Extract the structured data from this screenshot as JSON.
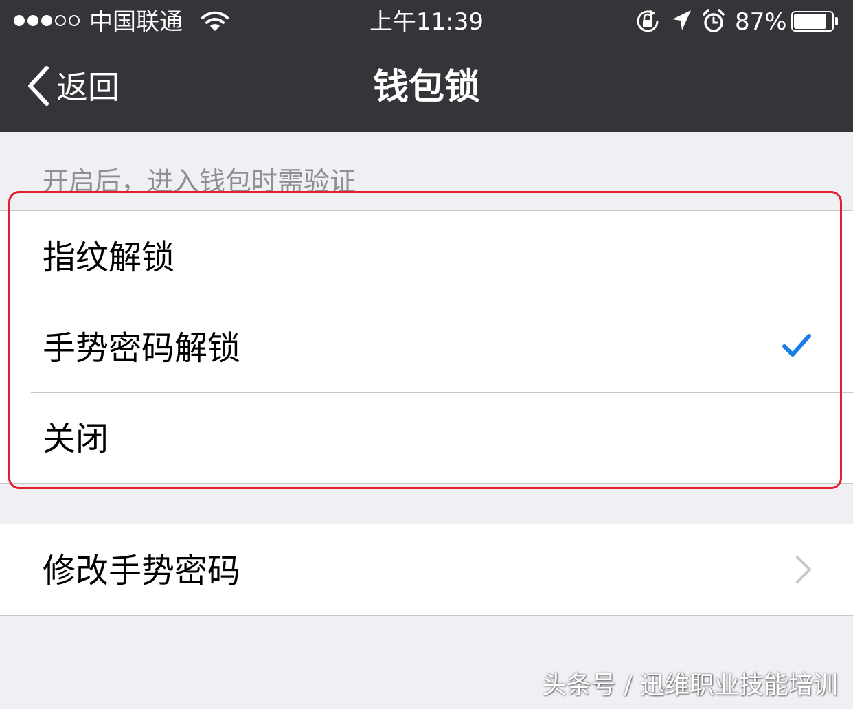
{
  "status_bar": {
    "carrier": "中国联通",
    "time": "上午11:39",
    "battery": "87%",
    "signal_bars_filled": 3,
    "signal_bars_total": 5,
    "battery_level": 0.87,
    "icons": [
      "wifi-icon",
      "rotation-lock-icon",
      "location-arrow-icon",
      "alarm-icon",
      "battery-icon"
    ]
  },
  "nav": {
    "back_label": "返回",
    "title": "钱包锁"
  },
  "lock_section": {
    "caption": "开启后，进入钱包时需验证",
    "options": [
      {
        "label": "指纹解锁",
        "selected": false
      },
      {
        "label": "手势密码解锁",
        "selected": true
      },
      {
        "label": "关闭",
        "selected": false
      }
    ]
  },
  "gesture_section": {
    "change_label": "修改手势密码"
  },
  "watermark": "头条号 / 迅维职业技能培训",
  "colors": {
    "nav_background": "#353539",
    "page_background": "#efeff4",
    "checkmark": "#1a7de3",
    "highlight": "#e0202e",
    "caption": "#8e8e93",
    "chevron": "#c7c7cc"
  }
}
